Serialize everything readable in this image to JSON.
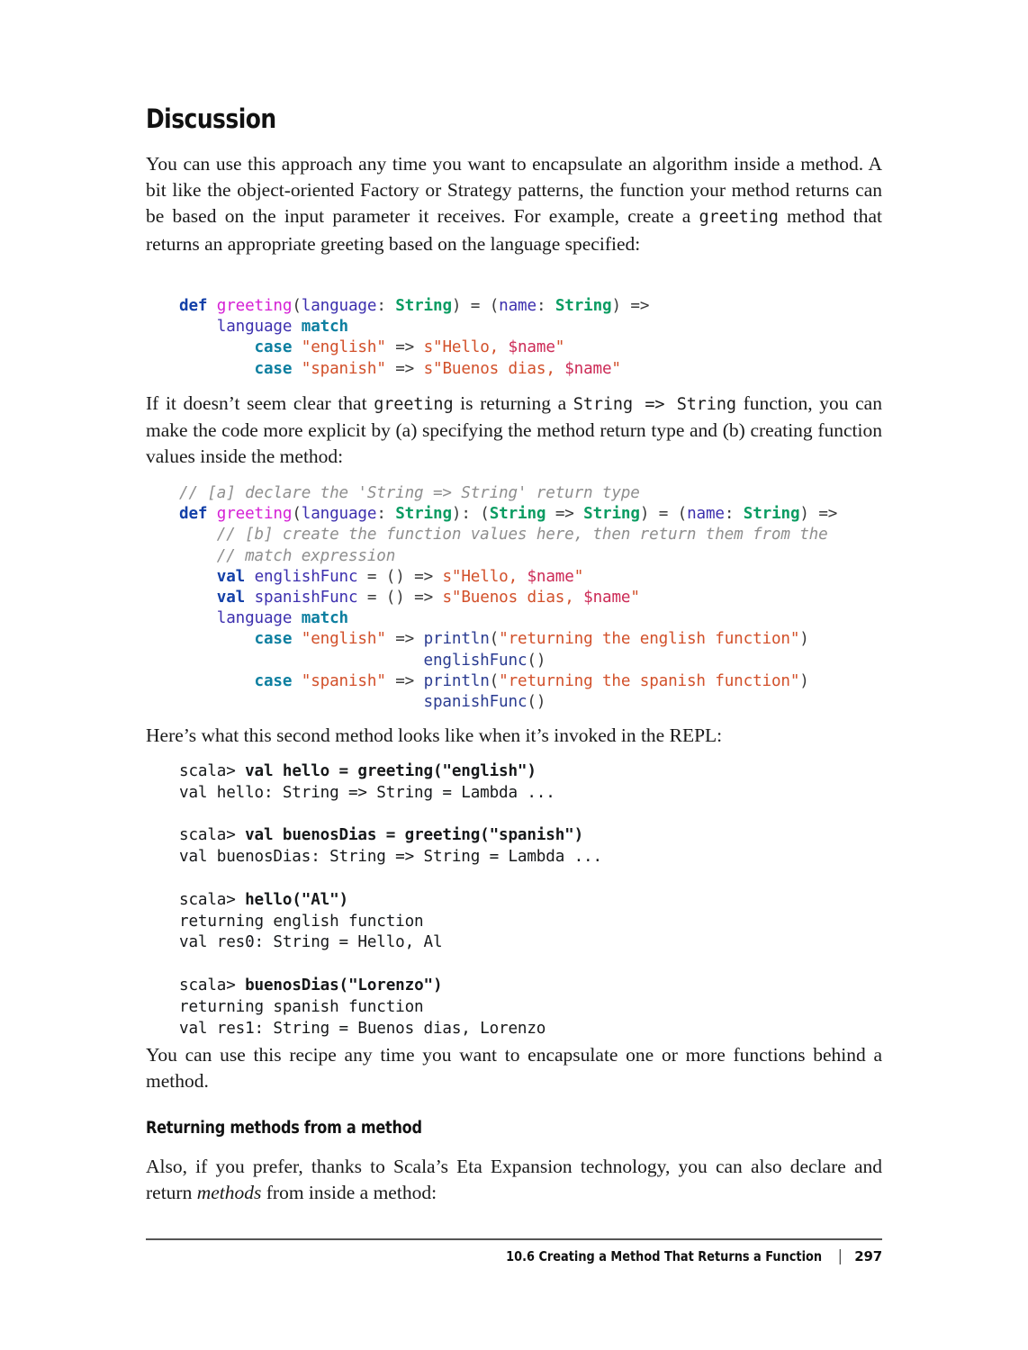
{
  "page": {
    "heading": "Discussion",
    "subheading": "Returning methods from a method",
    "footer_title": "10.6 Creating a Method That Returns a Function",
    "footer_separator": "|",
    "page_number": "297"
  },
  "paragraphs": {
    "p1_a": "You can use this approach any time you want to encapsulate an algorithm inside a method. A bit like the object-oriented Factory or Strategy patterns, the function your method returns can be based on the input parameter it receives. For example, create a ",
    "p1_code": "greeting",
    "p1_b": " method that returns an appropriate greeting based on the language specified:",
    "p2_a": "If it doesn’t seem clear that ",
    "p2_code1": "greeting",
    "p2_b": " is returning a ",
    "p2_code2": "String => String",
    "p2_c": " function, you can make the code more explicit by (a) specifying the method return type and (b) creating function values inside the method:",
    "p3": "Here’s what this second method looks like when it’s invoked in the REPL:",
    "p4": "You can use this recipe any time you want to encapsulate one or more functions behind a method.",
    "p5_a": "Also, if you prefer, thanks to Scala’s Eta Expansion technology, you can also declare and return ",
    "p5_em": "methods",
    "p5_b": " from inside a method:"
  },
  "code_block_1": {
    "lines": [
      "def greeting(language: String) = (name: String) =>",
      "    language match",
      "        case \"english\" => s\"Hello, $name\"",
      "        case \"spanish\" => s\"Buenos dias, $name\""
    ]
  },
  "code_block_2": {
    "lines": [
      "// [a] declare the 'String => String' return type",
      "def greeting(language: String): (String => String) = (name: String) =>",
      "    // [b] create the function values here, then return them from the",
      "    // match expression",
      "    val englishFunc = () => s\"Hello, $name\"",
      "    val spanishFunc = () => s\"Buenos dias, $name\"",
      "    language match",
      "        case \"english\" => println(\"returning the english function\")",
      "                          englishFunc()",
      "        case \"spanish\" => println(\"returning the spanish function\")",
      "                          spanishFunc()"
    ]
  },
  "repl_block": {
    "lines": [
      {
        "prompt": "scala> ",
        "input": "val hello = greeting(\"english\")"
      },
      {
        "output": "val hello: String => String = Lambda ..."
      },
      {
        "output": ""
      },
      {
        "prompt": "scala> ",
        "input": "val buenosDias = greeting(\"spanish\")"
      },
      {
        "output": "val buenosDias: String => String = Lambda ..."
      },
      {
        "output": ""
      },
      {
        "prompt": "scala> ",
        "input": "hello(\"Al\")"
      },
      {
        "output": "returning english function"
      },
      {
        "output": "val res0: String = Hello, Al"
      },
      {
        "output": ""
      },
      {
        "prompt": "scala> ",
        "input": "buenosDias(\"Lorenzo\")"
      },
      {
        "output": "returning spanish function"
      },
      {
        "output": "val res1: String = Buenos dias, Lorenzo"
      }
    ]
  },
  "colors": {
    "keyword": "#1340a8",
    "function_name": "#d520d5",
    "identifier": "#3c2fae",
    "type": "#0a9c62",
    "case_keyword": "#0d7fa0",
    "string": "#d2502a",
    "interpolation": "#cc2a56",
    "call": "#2a3b91",
    "comment": "#8e8e8e",
    "rule": "#555555"
  }
}
